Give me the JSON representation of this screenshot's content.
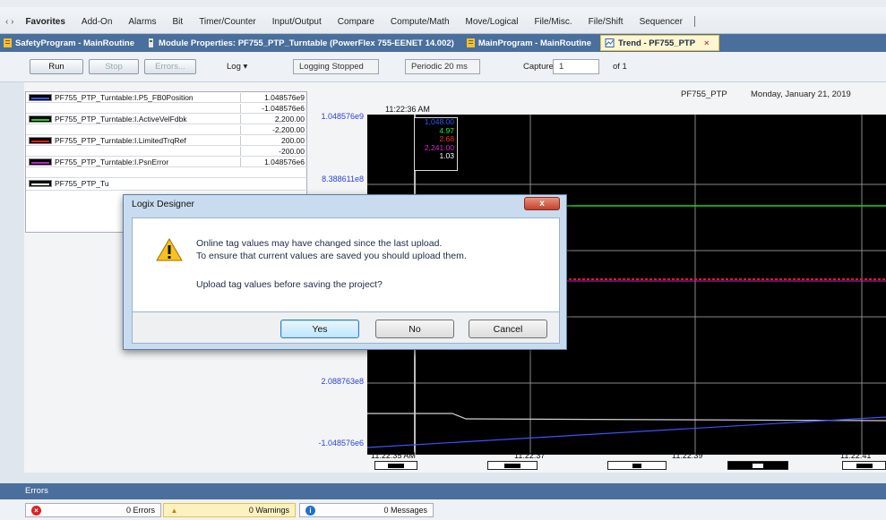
{
  "ribbon": {
    "nav": "‹ ›",
    "tabs": [
      "Favorites",
      "Add-On",
      "Alarms",
      "Bit",
      "Timer/Counter",
      "Input/Output",
      "Compare",
      "Compute/Math",
      "Move/Logical",
      "File/Misc.",
      "File/Shift",
      "Sequencer"
    ]
  },
  "doc_tabs": [
    {
      "label": "SafetyProgram - MainRoutine",
      "icon": "routine-icon",
      "active": false
    },
    {
      "label": "Module Properties: PF755_PTP_Turntable (PowerFlex 755-EENET 14.002)",
      "icon": "module-icon",
      "active": false
    },
    {
      "label": "MainProgram - MainRoutine",
      "icon": "routine-icon",
      "active": false
    },
    {
      "label": "Trend - PF755_PTP",
      "icon": "trend-icon",
      "active": true,
      "close": "×"
    }
  ],
  "toolbar": {
    "run": "Run",
    "stop": "Stop",
    "errors": "Errors...",
    "log": "Log ▾",
    "logging_status": "Logging Stopped",
    "periodic": "Periodic 20 ms",
    "capture_label": "Capture:",
    "capture_value": "1",
    "capture_of": "of 1"
  },
  "trend": {
    "name": "PF755_PTP",
    "date": "Monday, January 21, 2019",
    "cursor_time": "11:22:36 AM",
    "y_labels": [
      "1.048576e9",
      "8.388611e8",
      "2.088763e8",
      "-1.048576e6"
    ],
    "x_labels": [
      "11:22:35 AM",
      "11:22:37",
      "11:22:39",
      "11:22:41"
    ],
    "pens": [
      {
        "name": "PF755_PTP_Turntable:I.P5_FB0Position",
        "max": "1.048576e9",
        "min": "-1.048576e6",
        "color": "#3a52ff"
      },
      {
        "name": "PF755_PTP_Turntable:I.ActiveVelFdbk",
        "max": "2,200.00",
        "min": "-2,200.00",
        "color": "#1fd41f"
      },
      {
        "name": "PF755_PTP_Turntable:I.LimitedTrqRef",
        "max": "200.00",
        "min": "-200.00",
        "color": "#e0182a"
      },
      {
        "name": "PF755_PTP_Turntable:I.PsnError",
        "max": "1.048576e6",
        "min": "",
        "color": "#c21ec2"
      },
      {
        "name": "PF755_PTP_Tu",
        "max": "",
        "min": "",
        "color": "#ffffff"
      }
    ],
    "cursor_values": [
      {
        "text": "1,048.00",
        "color": "#3a52ff"
      },
      {
        "text": "4.97",
        "color": "#27e827"
      },
      {
        "text": "2.68",
        "color": "#ff2a2a"
      },
      {
        "text": "2,241.00",
        "color": "#d22ad2"
      },
      {
        "text": "1.03",
        "color": "#ffffff"
      }
    ]
  },
  "dialog": {
    "title": "Logix Designer",
    "close": "x",
    "line1": "Online tag values may have changed since the last upload.",
    "line2": "To ensure that current values are saved you should upload them.",
    "line3": "Upload tag values before saving the project?",
    "yes": "Yes",
    "no": "No",
    "cancel": "Cancel"
  },
  "errors": {
    "header": "Errors",
    "errors_count": "0 Errors",
    "warnings_count": "0 Warnings",
    "messages_count": "0 Messages"
  }
}
